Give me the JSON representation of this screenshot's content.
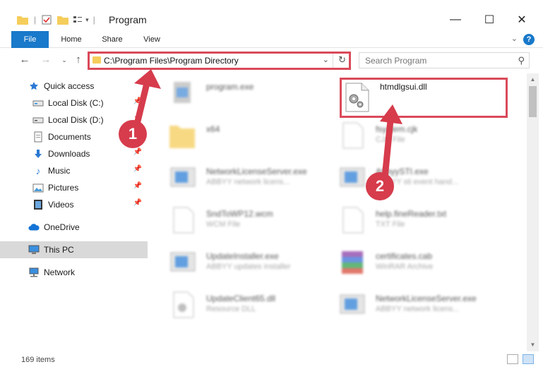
{
  "window": {
    "title": "Program",
    "minimize": "—",
    "maximize": "☐",
    "close": "✕"
  },
  "ribbon": {
    "tabs": [
      {
        "label": "File"
      },
      {
        "label": "Home"
      },
      {
        "label": "Share"
      },
      {
        "label": "View"
      }
    ],
    "help": "?"
  },
  "address": {
    "path": "C:\\Program Files\\Program Directory",
    "search_placeholder": "Search Program"
  },
  "sidebar": {
    "items": [
      {
        "label": "Quick access",
        "icon": "star-icon"
      },
      {
        "label": "Local Disk (C:)",
        "icon": "drive-icon"
      },
      {
        "label": "Local Disk (D:)",
        "icon": "drive-icon"
      },
      {
        "label": "Documents",
        "icon": "documents-icon"
      },
      {
        "label": "Downloads",
        "icon": "download-icon"
      },
      {
        "label": "Music",
        "icon": "music-icon"
      },
      {
        "label": "Pictures",
        "icon": "pictures-icon"
      },
      {
        "label": "Videos",
        "icon": "videos-icon"
      },
      {
        "label": "OneDrive",
        "icon": "cloud-icon"
      },
      {
        "label": "This PC",
        "icon": "computer-icon"
      },
      {
        "label": "Network",
        "icon": "network-icon"
      }
    ]
  },
  "files": [
    {
      "name": "program.exe",
      "desc": ""
    },
    {
      "name": "htmdlgsui.dll",
      "desc": ""
    },
    {
      "name": "x64",
      "desc": ""
    },
    {
      "name": "fsystem.cjk",
      "desc": "CJK File"
    },
    {
      "name": "NetworkLicenseServer.exe",
      "desc": "ABBYY network licens..."
    },
    {
      "name": "AbbyySTI.exe",
      "desc": "ABBYY sti event hand..."
    },
    {
      "name": "SndToWP12.wcm",
      "desc": "WCM File"
    },
    {
      "name": "help.fineReader.txt",
      "desc": "TXT File"
    },
    {
      "name": "UpdateInstaller.exe",
      "desc": "ABBYY updates installer"
    },
    {
      "name": "certificates.cab",
      "desc": "WinRAR Archive"
    },
    {
      "name": "UpdateClient65.dll",
      "desc": "Resource DLL"
    },
    {
      "name": "NetworkLicenseServer.exe",
      "desc": "ABBYY network licens..."
    }
  ],
  "annotations": {
    "step1": "1",
    "step2": "2"
  },
  "status": {
    "count": "169 items"
  },
  "colors": {
    "accent": "#1979ca",
    "highlight": "#d94a5a",
    "badge": "#d63c4c"
  }
}
